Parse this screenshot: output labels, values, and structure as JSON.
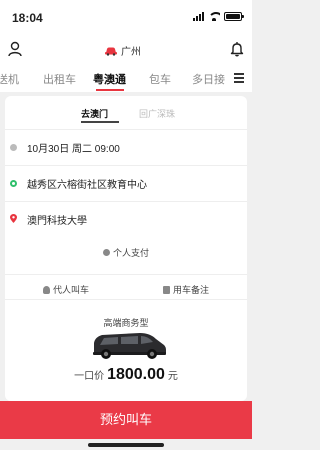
{
  "status_bar": {
    "time": "18:04"
  },
  "header": {
    "city": "广州",
    "icons": [
      "user-icon",
      "car-icon",
      "bell-icon"
    ]
  },
  "tabs": [
    {
      "label": "送机",
      "active": false
    },
    {
      "label": "出租车",
      "active": false
    },
    {
      "label": "粤澳通",
      "active": true
    },
    {
      "label": "包车",
      "active": false
    },
    {
      "label": "多日接",
      "active": false
    }
  ],
  "subtabs": [
    {
      "label": "去澳门",
      "active": true
    },
    {
      "label": "回广深珠",
      "active": false
    }
  ],
  "trip": {
    "time": "10月30日 周二 09:00",
    "from": "越秀区六榕街社区教育中心",
    "to": "澳門科技大學"
  },
  "payment": {
    "label": "个人支付"
  },
  "actions": {
    "proxy": "代人叫车",
    "note": "用车备注"
  },
  "vehicle": {
    "type": "高端商务型"
  },
  "price": {
    "label": "一口价",
    "value": "1800.00",
    "unit": "元"
  },
  "book_button": {
    "label": "预约叫车"
  },
  "colors": {
    "accent": "#ea3a47",
    "green": "#2fbf6b"
  }
}
